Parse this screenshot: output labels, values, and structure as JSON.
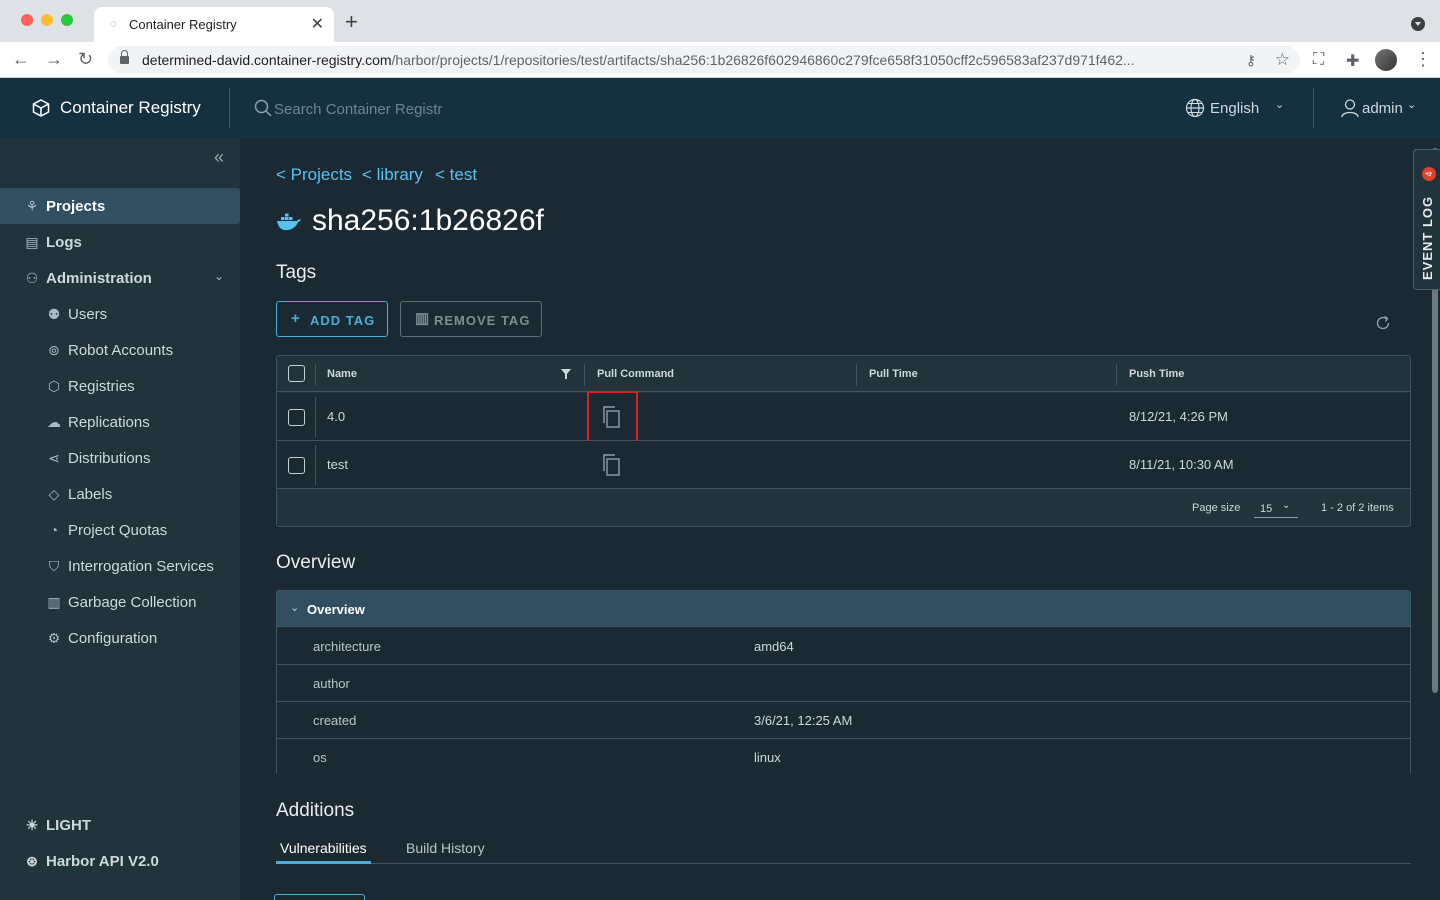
{
  "browser": {
    "tab_title": "Container Registry",
    "url_host": "determined-david.container-registry.com",
    "url_path": "/harbor/projects/1/repositories/test/artifacts/sha256:1b26826f602946860c279fce658f31050cff2c596583af237d971f462..."
  },
  "header": {
    "brand": "Container Registry",
    "search_placeholder": "Search Container Registr",
    "language": "English",
    "user": "admin"
  },
  "sidebar": {
    "items": [
      {
        "label": "Projects",
        "icon": "projects-icon"
      },
      {
        "label": "Logs",
        "icon": "logs-icon"
      },
      {
        "label": "Administration",
        "icon": "administration-icon"
      },
      {
        "label": "Users",
        "icon": "users-icon"
      },
      {
        "label": "Robot Accounts",
        "icon": "robot-icon"
      },
      {
        "label": "Registries",
        "icon": "registries-icon"
      },
      {
        "label": "Replications",
        "icon": "replications-icon"
      },
      {
        "label": "Distributions",
        "icon": "distributions-icon"
      },
      {
        "label": "Labels",
        "icon": "labels-icon"
      },
      {
        "label": "Project Quotas",
        "icon": "quotas-icon"
      },
      {
        "label": "Interrogation Services",
        "icon": "shield-icon"
      },
      {
        "label": "Garbage Collection",
        "icon": "trash-icon"
      },
      {
        "label": "Configuration",
        "icon": "gear-icon"
      }
    ],
    "theme_label": "LIGHT",
    "api_label": "Harbor API V2.0"
  },
  "breadcrumbs": [
    "< Projects",
    "< library",
    "< test"
  ],
  "page_title": "sha256:1b26826f",
  "tags_section": {
    "title": "Tags",
    "add_tag": "ADD TAG",
    "remove_tag": "REMOVE TAG",
    "columns": [
      "Name",
      "Pull Command",
      "Pull Time",
      "Push Time"
    ],
    "rows": [
      {
        "name": "4.0",
        "pull_time": "",
        "push_time": "8/12/21, 4:26 PM"
      },
      {
        "name": "test",
        "pull_time": "",
        "push_time": "8/11/21, 10:30 AM"
      }
    ],
    "page_size_label": "Page size",
    "page_size": "15",
    "count": "1 - 2 of 2 items"
  },
  "overview_section": {
    "title": "Overview",
    "panel_title": "Overview",
    "rows": [
      {
        "key": "architecture",
        "value": "amd64"
      },
      {
        "key": "author",
        "value": ""
      },
      {
        "key": "created",
        "value": "3/6/21, 12:25 AM"
      },
      {
        "key": "os",
        "value": "linux"
      }
    ]
  },
  "additions_section": {
    "title": "Additions",
    "tabs": [
      "Vulnerabilities",
      "Build History"
    ]
  },
  "event_log": {
    "label": "EVENT LOG",
    "count": "4"
  },
  "colors": {
    "accent": "#49afd9",
    "header_bg": "#15313f",
    "sidebar_bg": "#21333b",
    "main_bg": "#1b2a32",
    "highlight": "#e02020"
  }
}
